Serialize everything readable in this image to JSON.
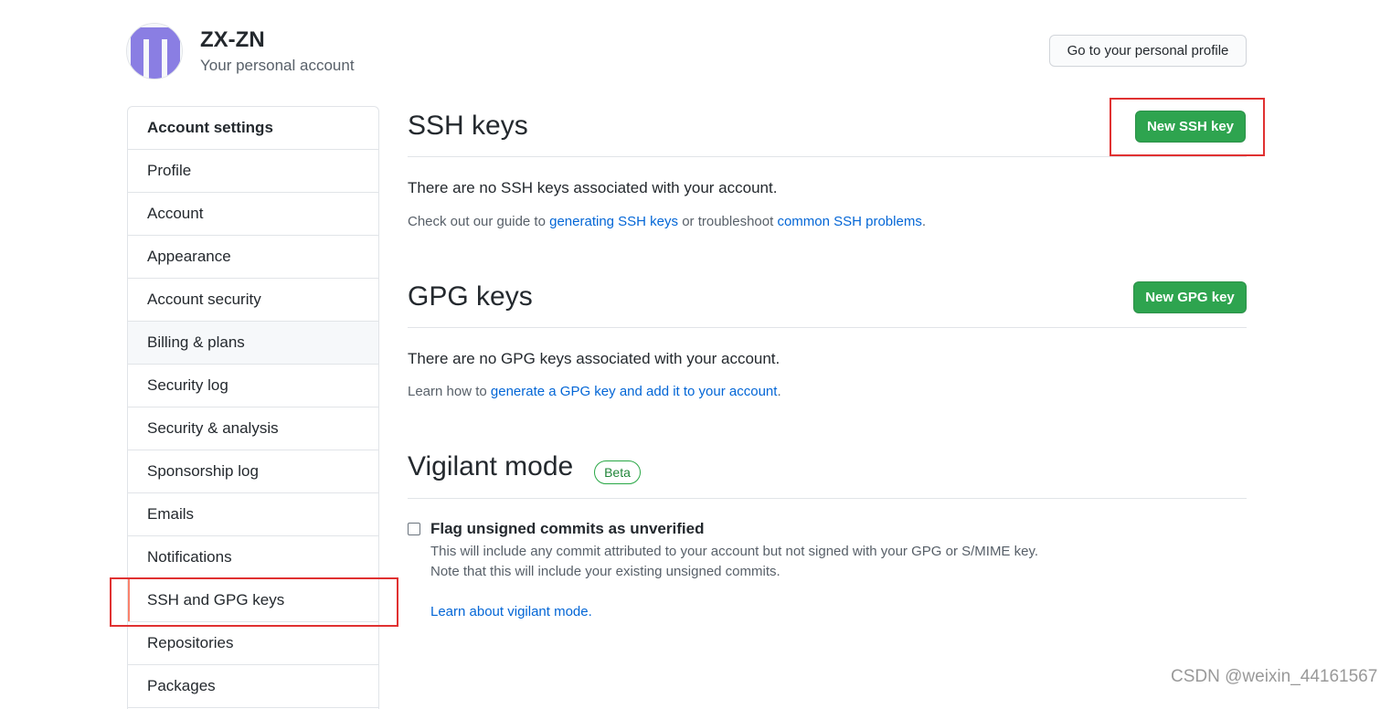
{
  "header": {
    "account_name": "ZX-ZN",
    "account_subtitle": "Your personal account",
    "profile_button": "Go to your personal profile"
  },
  "sidebar": {
    "heading": "Account settings",
    "items": [
      {
        "label": "Profile"
      },
      {
        "label": "Account"
      },
      {
        "label": "Appearance"
      },
      {
        "label": "Account security"
      },
      {
        "label": "Billing & plans"
      },
      {
        "label": "Security log"
      },
      {
        "label": "Security & analysis"
      },
      {
        "label": "Sponsorship log"
      },
      {
        "label": "Emails"
      },
      {
        "label": "Notifications"
      },
      {
        "label": "SSH and GPG keys"
      },
      {
        "label": "Repositories"
      },
      {
        "label": "Packages"
      }
    ]
  },
  "ssh": {
    "title": "SSH keys",
    "new_button": "New SSH key",
    "empty_text": "There are no SSH keys associated with your account.",
    "help_prefix": "Check out our guide to ",
    "help_link1": "generating SSH keys",
    "help_middle": " or troubleshoot ",
    "help_link2": "common SSH problems",
    "help_suffix": "."
  },
  "gpg": {
    "title": "GPG keys",
    "new_button": "New GPG key",
    "empty_text": "There are no GPG keys associated with your account.",
    "help_prefix": "Learn how to ",
    "help_link": "generate a GPG key and add it to your account",
    "help_suffix": "."
  },
  "vigilant": {
    "title": "Vigilant mode",
    "badge": "Beta",
    "checkbox_label": "Flag unsigned commits as unverified",
    "checked": false,
    "note_line1": "This will include any commit attributed to your account but not signed with your GPG or S/MIME key.",
    "note_line2": "Note that this will include your existing unsigned commits.",
    "learn_link": "Learn about vigilant mode",
    "learn_suffix": "."
  },
  "watermark": "CSDN @weixin_44161567",
  "colors": {
    "primary_button": "#2ea44f",
    "link": "#0366d6",
    "selected_marker": "#f9826c",
    "annotation_box": "#e03131",
    "avatar": "#8a7ee3"
  }
}
